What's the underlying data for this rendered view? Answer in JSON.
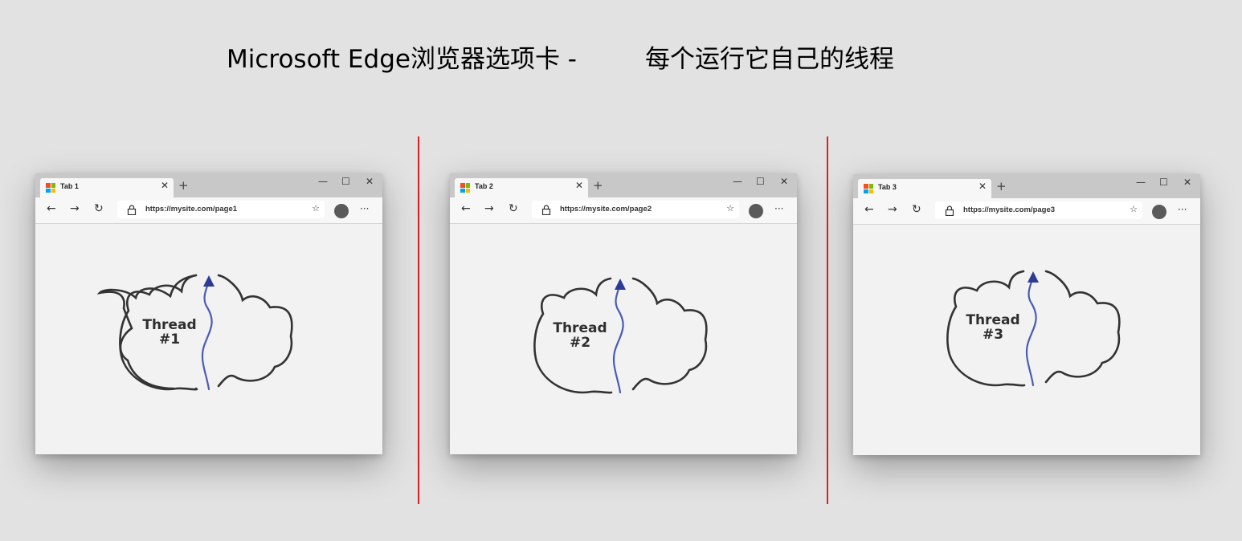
{
  "title": {
    "left": "Microsoft Edge浏览器选项卡 -",
    "right": "每个运行它自己的线程"
  },
  "windows": [
    {
      "tab_label": "Tab 1",
      "url": "https://mysite.com/page1",
      "thread_line1": "Thread",
      "thread_line2": "#1"
    },
    {
      "tab_label": "Tab 2",
      "url": "https://mysite.com/page2",
      "thread_line1": "Thread",
      "thread_line2": "#2"
    },
    {
      "tab_label": "Tab 3",
      "url": "https://mysite.com/page3",
      "thread_line1": "Thread",
      "thread_line2": "#3"
    }
  ],
  "chrome": {
    "close_glyph": "✕",
    "new_tab_glyph": "+",
    "minimize_glyph": "—",
    "maximize_glyph": "☐",
    "back_glyph": "←",
    "forward_glyph": "→",
    "refresh_glyph": "↻",
    "favorite_glyph": "☆",
    "more_glyph": "···"
  },
  "colors": {
    "divider": "#e02020",
    "thread_arrow": "#4a5bb5",
    "cloud_outline": "#333333",
    "logo_red": "#f25022",
    "logo_green": "#7fba00",
    "logo_blue": "#00a4ef",
    "logo_yellow": "#ffb900"
  },
  "icons": [
    "microsoft-logo-icon",
    "close-icon",
    "new-tab-icon",
    "minimize-icon",
    "maximize-icon",
    "back-icon",
    "forward-icon",
    "refresh-icon",
    "lock-icon",
    "favorite-star-icon",
    "profile-avatar-icon",
    "more-icon",
    "cloud-icon",
    "thread-arrow-icon"
  ]
}
